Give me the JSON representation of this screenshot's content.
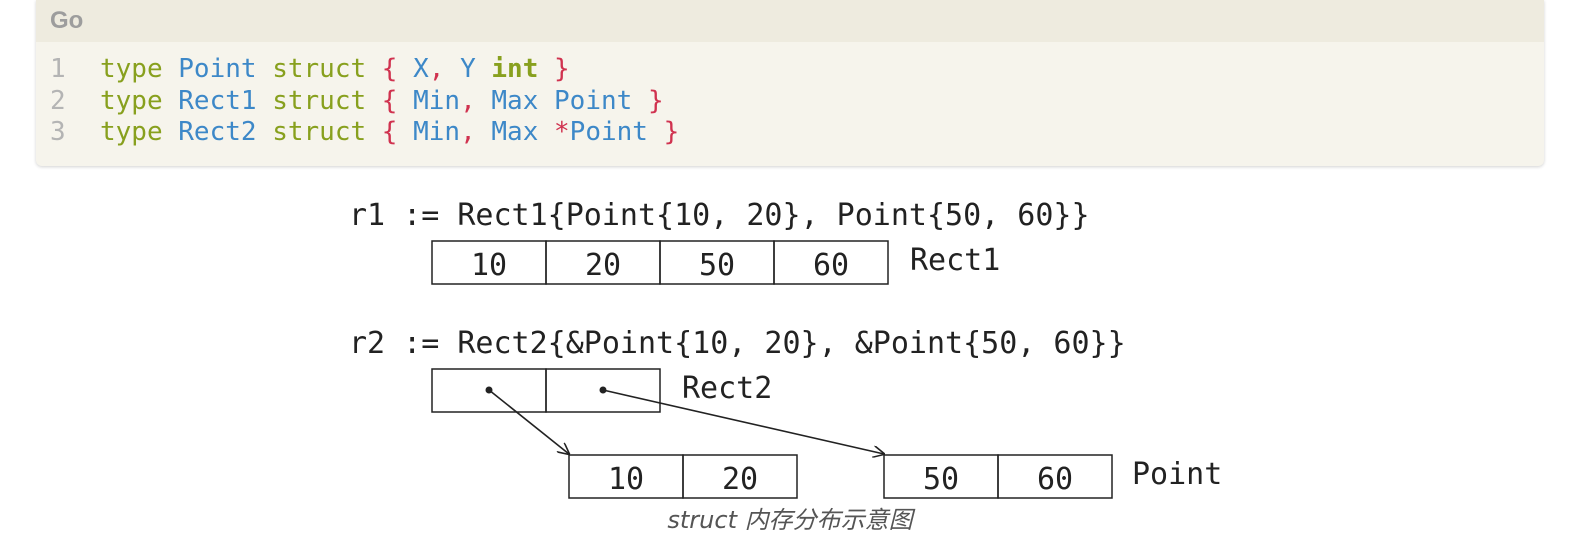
{
  "code_block": {
    "language": "Go",
    "lines": [
      {
        "number": "1",
        "tokens": [
          {
            "t": "type",
            "c": "kw"
          },
          {
            "t": " ",
            "c": "sp"
          },
          {
            "t": "Point",
            "c": "id"
          },
          {
            "t": " ",
            "c": "sp"
          },
          {
            "t": "struct",
            "c": "kw"
          },
          {
            "t": " ",
            "c": "sp"
          },
          {
            "t": "{",
            "c": "br"
          },
          {
            "t": " ",
            "c": "sp"
          },
          {
            "t": "X",
            "c": "id"
          },
          {
            "t": ",",
            "c": "br"
          },
          {
            "t": " ",
            "c": "sp"
          },
          {
            "t": "Y",
            "c": "id"
          },
          {
            "t": " ",
            "c": "sp"
          },
          {
            "t": "int",
            "c": "ty"
          },
          {
            "t": " ",
            "c": "sp"
          },
          {
            "t": "}",
            "c": "br"
          }
        ]
      },
      {
        "number": "2",
        "tokens": [
          {
            "t": "type",
            "c": "kw"
          },
          {
            "t": " ",
            "c": "sp"
          },
          {
            "t": "Rect1",
            "c": "id"
          },
          {
            "t": " ",
            "c": "sp"
          },
          {
            "t": "struct",
            "c": "kw"
          },
          {
            "t": " ",
            "c": "sp"
          },
          {
            "t": "{",
            "c": "br"
          },
          {
            "t": " ",
            "c": "sp"
          },
          {
            "t": "Min",
            "c": "id"
          },
          {
            "t": ",",
            "c": "br"
          },
          {
            "t": " ",
            "c": "sp"
          },
          {
            "t": "Max",
            "c": "id"
          },
          {
            "t": " ",
            "c": "sp"
          },
          {
            "t": "Point",
            "c": "id"
          },
          {
            "t": " ",
            "c": "sp"
          },
          {
            "t": "}",
            "c": "br"
          }
        ]
      },
      {
        "number": "3",
        "tokens": [
          {
            "t": "type",
            "c": "kw"
          },
          {
            "t": " ",
            "c": "sp"
          },
          {
            "t": "Rect2",
            "c": "id"
          },
          {
            "t": " ",
            "c": "sp"
          },
          {
            "t": "struct",
            "c": "kw"
          },
          {
            "t": " ",
            "c": "sp"
          },
          {
            "t": "{",
            "c": "br"
          },
          {
            "t": " ",
            "c": "sp"
          },
          {
            "t": "Min",
            "c": "id"
          },
          {
            "t": ",",
            "c": "br"
          },
          {
            "t": " ",
            "c": "sp"
          },
          {
            "t": "Max",
            "c": "id"
          },
          {
            "t": " ",
            "c": "sp"
          },
          {
            "t": "*",
            "c": "br"
          },
          {
            "t": "Point",
            "c": "id"
          },
          {
            "t": " ",
            "c": "sp"
          },
          {
            "t": "}",
            "c": "br"
          }
        ]
      }
    ]
  },
  "diagram": {
    "r1_decl": "r1 := Rect1{Point{10, 20}, Point{50, 60}}",
    "rect1_cells": [
      "10",
      "20",
      "50",
      "60"
    ],
    "rect1_label": "Rect1",
    "r2_decl": "r2 := Rect2{&Point{10, 20}, &Point{50, 60}}",
    "rect2_label": "Rect2",
    "point_a_cells": [
      "10",
      "20"
    ],
    "point_b_cells": [
      "50",
      "60"
    ],
    "point_label": "Point"
  },
  "caption": "struct 内存分布示意图",
  "colors": {
    "keyword": "#88a01e",
    "identifier": "#3d88c8",
    "punct": "#d0324f",
    "line_number": "#b4b4b4",
    "code_bg": "#f6f4ec",
    "header_bg": "#eeebdf"
  }
}
